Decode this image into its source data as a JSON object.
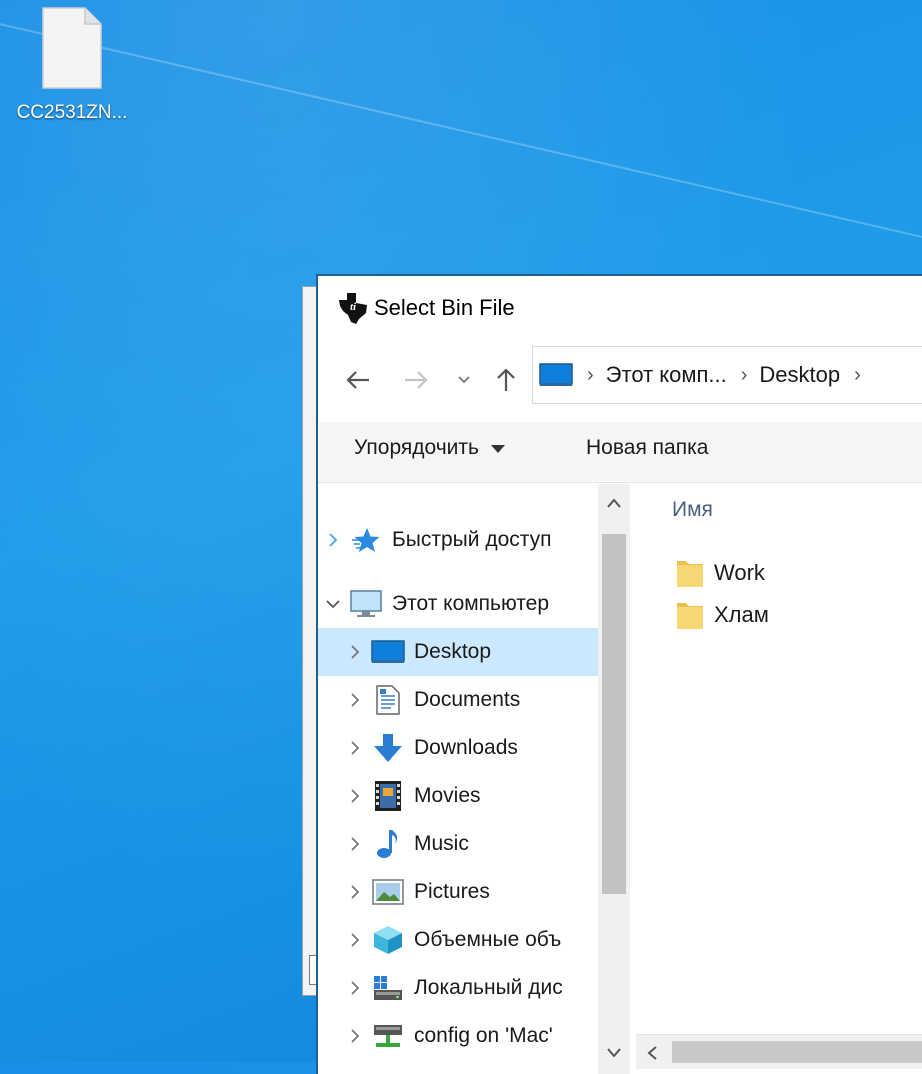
{
  "desktop": {
    "icon_label": "CC2531ZN..."
  },
  "dialog": {
    "title": "Select Bin File",
    "address": [
      "Этот комп...",
      "Desktop"
    ],
    "toolbar": {
      "organize": "Упорядочить",
      "new_folder": "Новая папка"
    },
    "tree": [
      {
        "label": "Быстрый доступ",
        "icon": "quick-access-star-icon",
        "expanded": false
      },
      {
        "label": "Этот компьютер",
        "icon": "computer-icon",
        "expanded": true
      },
      {
        "label": "Desktop",
        "icon": "desktop-icon",
        "selected": true
      },
      {
        "label": "Documents",
        "icon": "documents-icon"
      },
      {
        "label": "Downloads",
        "icon": "downloads-icon"
      },
      {
        "label": "Movies",
        "icon": "movies-icon"
      },
      {
        "label": "Music",
        "icon": "music-icon"
      },
      {
        "label": "Pictures",
        "icon": "pictures-icon"
      },
      {
        "label": "Объемные объ",
        "icon": "3d-objects-icon"
      },
      {
        "label": "Локальный дис",
        "icon": "local-disk-icon"
      },
      {
        "label": "config on 'Mac'",
        "icon": "network-drive-icon"
      }
    ],
    "column_name": "Имя",
    "files": [
      {
        "label": "Work",
        "icon": "folder-icon"
      },
      {
        "label": "Хлам",
        "icon": "folder-icon"
      }
    ],
    "colors": {
      "accent_border": "#1e5f92",
      "selection": "#cce8ff",
      "folder": "#f7d774"
    }
  }
}
